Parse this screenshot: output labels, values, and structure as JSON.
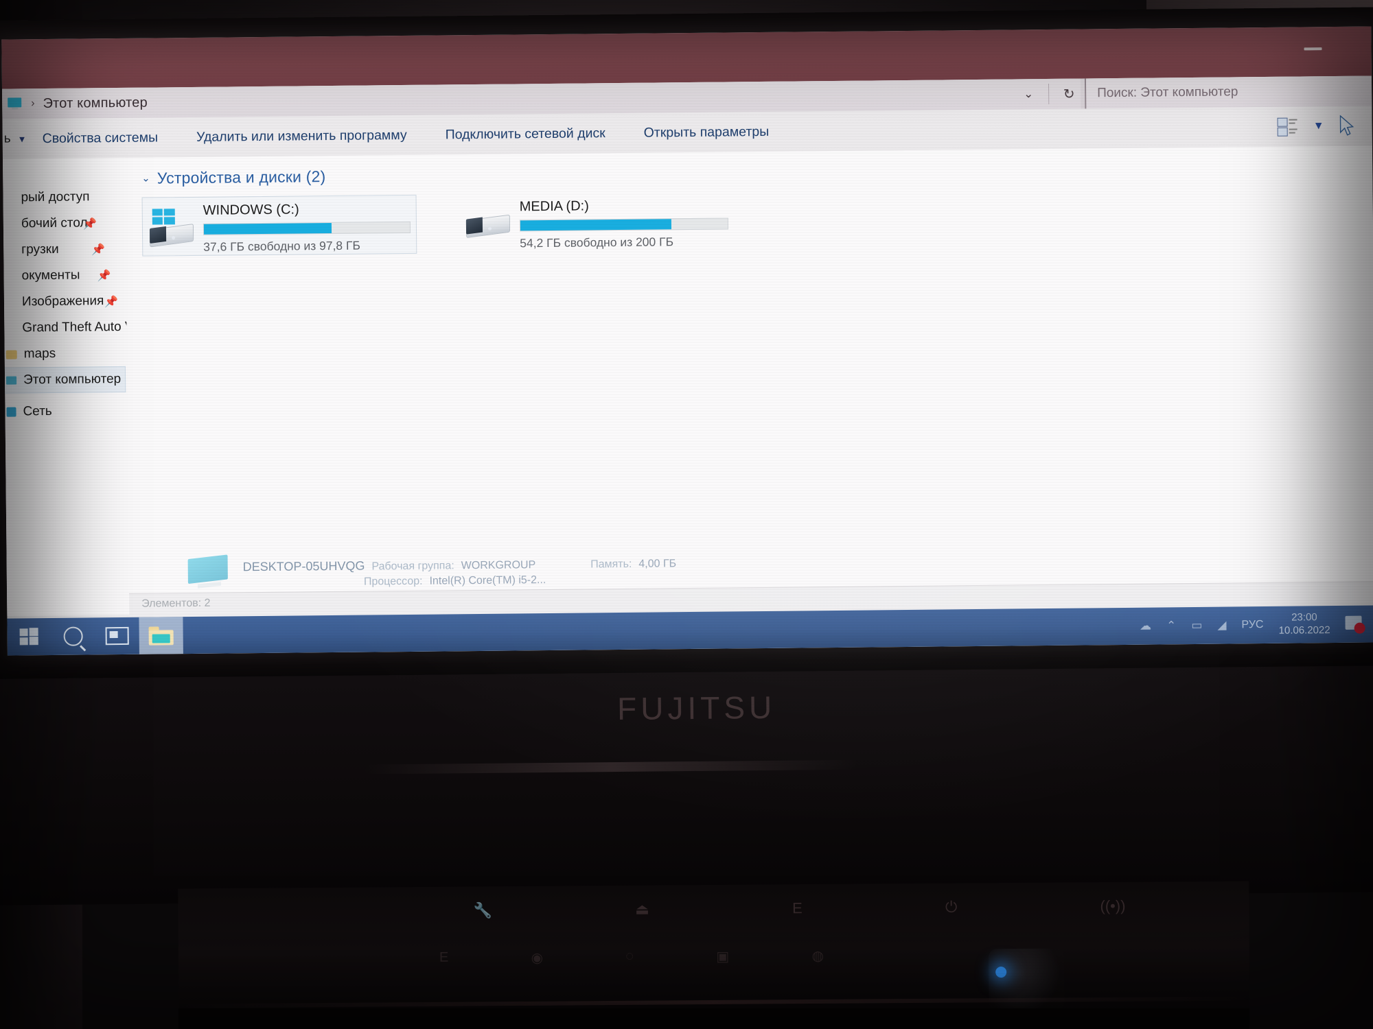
{
  "window": {
    "title": "Этот компьютер",
    "minimize_label": "—",
    "titlebar_color": "#8a4d55"
  },
  "address_bar": {
    "breadcrumb_separator": "›",
    "breadcrumb": "Этот компьютер",
    "dropdown_icon": "chevron-down-icon",
    "refresh_icon": "refresh-icon"
  },
  "search": {
    "placeholder": "Поиск: Этот компьютер"
  },
  "toolbar": {
    "first_item_label": "ь",
    "items": [
      "Свойства системы",
      "Удалить или изменить программу",
      "Подключить сетевой диск",
      "Открыть параметры"
    ],
    "view_icon": "details-view-icon",
    "view_caret": "▼",
    "cursor_icon": "mouse-pointer-icon"
  },
  "sidebar": {
    "items": [
      {
        "label": "рый доступ",
        "icon": "quick-access-icon",
        "pinned": false,
        "selected": false
      },
      {
        "label": "бочий стол",
        "icon": "desktop-icon",
        "pinned": true,
        "selected": false
      },
      {
        "label": "грузки",
        "icon": "downloads-icon",
        "pinned": true,
        "selected": false
      },
      {
        "label": "окументы",
        "icon": "documents-icon",
        "pinned": true,
        "selected": false
      },
      {
        "label": "Изображения",
        "icon": "pictures-icon",
        "pinned": true,
        "selected": false
      },
      {
        "label": "Grand Theft Auto V",
        "icon": "folder-icon",
        "pinned": false,
        "selected": false
      },
      {
        "label": "maps",
        "icon": "folder-icon",
        "pinned": false,
        "selected": false
      },
      {
        "label": "Этот компьютер",
        "icon": "this-pc-icon",
        "pinned": false,
        "selected": true
      },
      {
        "label": "Сеть",
        "icon": "network-icon",
        "pinned": false,
        "selected": false
      }
    ],
    "pin_glyph": "📌"
  },
  "main": {
    "group": {
      "caret": "⌄",
      "title": "Устройства и диски (2)"
    },
    "drives": [
      {
        "name": "WINDOWS (C:)",
        "free_text": "37,6 ГБ свободно из 97,8 ГБ",
        "free_gb": 37.6,
        "total_gb": 97.8,
        "used_percent": 62,
        "icon": "windows-system-drive-icon",
        "bar_color": "#18aee0"
      },
      {
        "name": "MEDIA (D:)",
        "free_text": "54,2 ГБ свободно из 200 ГБ",
        "free_gb": 54.2,
        "total_gb": 200,
        "used_percent": 73,
        "icon": "hard-drive-icon",
        "bar_color": "#18aee0"
      }
    ]
  },
  "details_pane": {
    "computer_name": "DESKTOP-05UHVQG",
    "workgroup_label": "Рабочая группа:",
    "workgroup_value": "WORKGROUP",
    "memory_label": "Память:",
    "memory_value": "4,00 ГБ",
    "processor_label": "Процессор:",
    "processor_value": "Intel(R) Core(TM) i5-2...",
    "icon": "this-pc-icon"
  },
  "status_bar": {
    "item_count_text": "Элементов: 2"
  },
  "taskbar": {
    "start_icon": "windows-start-icon",
    "search_icon": "search-icon",
    "task_view_icon": "task-view-icon",
    "file_explorer_icon": "file-explorer-icon",
    "tray": {
      "icons": [
        "onedrive-icon",
        "chevron-up-icon",
        "network-icon",
        "volume-icon"
      ],
      "language": "РУС",
      "time": "23:00",
      "date": "10.06.2022",
      "notification_icon": "notification-center-icon"
    }
  },
  "hardware": {
    "brand_logo": "FUJITSU",
    "fn_icons": [
      "wrench-icon",
      "eject-icon",
      "E",
      "power-icon",
      "wifi-icon"
    ],
    "key_icons": [
      "E",
      "camera-icon",
      "ecomode-icon",
      "calc-icon",
      "app-icon"
    ]
  }
}
